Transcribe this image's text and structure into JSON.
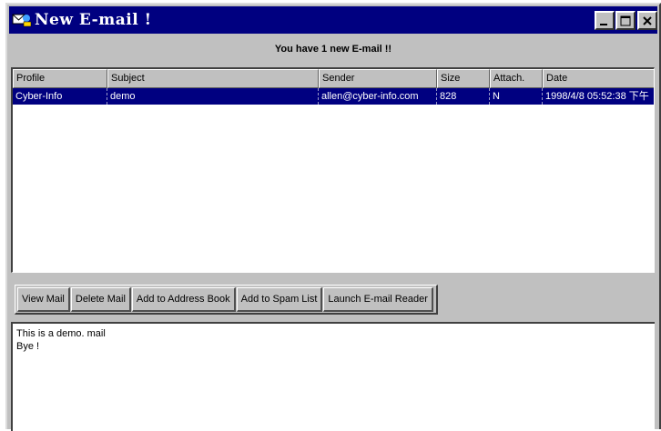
{
  "window": {
    "title": "New E-mail !",
    "buttons": {
      "minimize": "minimize",
      "maximize": "maximize",
      "close": "close"
    }
  },
  "notice": "You have 1 new E-mail !!",
  "table": {
    "columns": [
      "Profile",
      "Subject",
      "Sender",
      "Size",
      "Attach.",
      "Date"
    ],
    "rows": [
      {
        "profile": "Cyber-Info",
        "subject": "demo",
        "sender": "allen@cyber-info.com",
        "size": "828",
        "attach": "N",
        "date": "1998/4/8 05:52:38 下午"
      }
    ]
  },
  "actions": {
    "view": "View Mail",
    "delete": "Delete Mail",
    "address_book": "Add to Address Book",
    "spam": "Add to Spam List",
    "launch": "Launch E-mail Reader"
  },
  "message": {
    "line1": "This is a demo. mail",
    "line2": "Bye !"
  },
  "colors": {
    "titlebar": "#000080",
    "selection": "#000080",
    "face": "#c0c0c0"
  },
  "icons": [
    "mail-app-icon",
    "minimize-icon",
    "maximize-icon",
    "close-icon"
  ]
}
